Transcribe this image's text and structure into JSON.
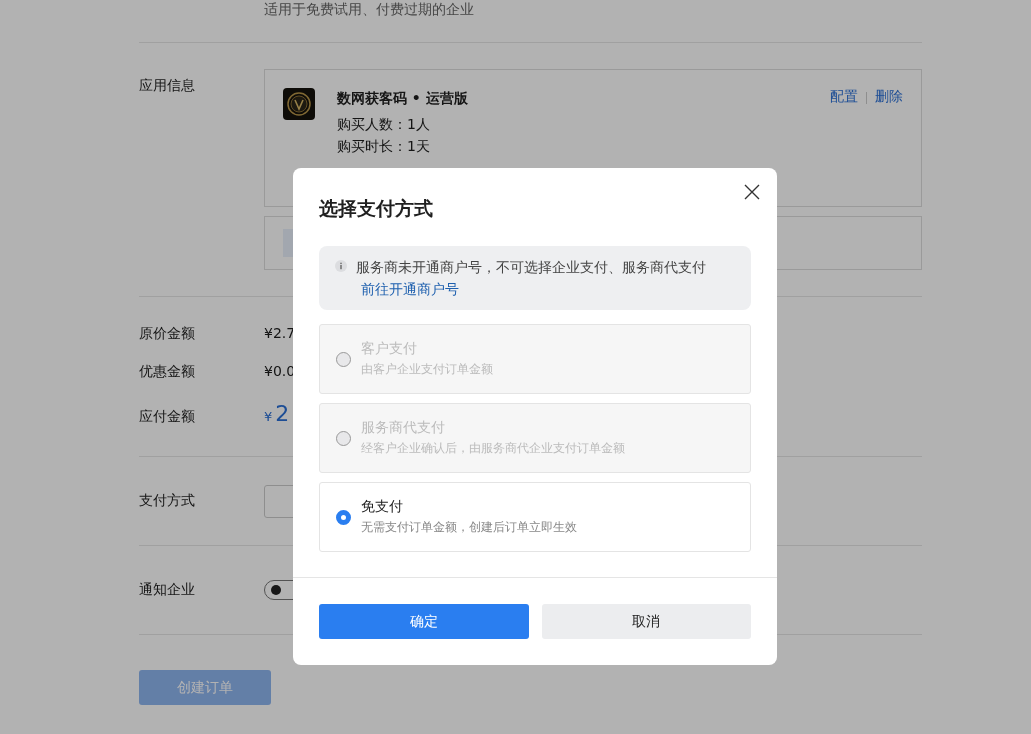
{
  "page": {
    "top_note": "适用于免费试用、付费过期的企业",
    "app_info": {
      "label": "应用信息",
      "app_name": "数网获客码 • 运营版",
      "details": [
        "购买人数：1人",
        "购买时长：1天"
      ],
      "actions": [
        "配置",
        "删除"
      ]
    },
    "prices": [
      {
        "label": "原价金额",
        "value": "¥2.7",
        "kind": "plain"
      },
      {
        "label": "优惠金额",
        "value": "¥0.0",
        "kind": "plain"
      },
      {
        "label": "应付金额",
        "currency": "¥",
        "value": "2",
        "kind": "big"
      }
    ],
    "payment": {
      "label": "支付方式"
    },
    "notify": {
      "label": "通知企业",
      "on": false
    },
    "create_button": {
      "label": "创建订单",
      "disabled": true
    }
  },
  "dialog": {
    "title": "选择支付方式",
    "notice": "服务商未开通商户号，不可选择企业支付、服务商代支付",
    "notice_link": "前往开通商户号",
    "options": [
      {
        "title": "客户支付",
        "desc": "由客户企业支付订单金额",
        "disabled": true,
        "selected": false
      },
      {
        "title": "服务商代支付",
        "desc": "经客户企业确认后，由服务商代企业支付订单金额",
        "disabled": true,
        "selected": false
      },
      {
        "title": "免支付",
        "desc": "无需支付订单金额，创建后订单立即生效",
        "disabled": false,
        "selected": true
      }
    ],
    "buttons": [
      {
        "label": "确定",
        "kind": "primary"
      },
      {
        "label": "取消",
        "kind": "secondary"
      }
    ]
  }
}
